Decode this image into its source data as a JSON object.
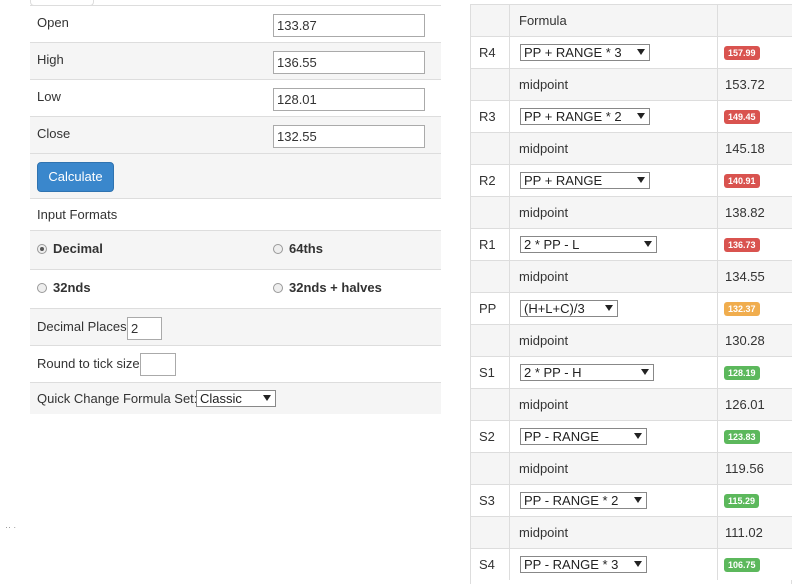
{
  "inputs": {
    "open_label": "Open",
    "open_value": "133.87",
    "high_label": "High",
    "high_value": "136.55",
    "low_label": "Low",
    "low_value": "128.01",
    "close_label": "Close",
    "close_value": "132.55"
  },
  "calculate_label": "Calculate",
  "input_formats": {
    "heading": "Input Formats",
    "options": [
      "Decimal",
      "64ths",
      "32nds",
      "32nds + halves"
    ],
    "selected": "Decimal"
  },
  "decimal_places": {
    "label": "Decimal Places",
    "value": "2"
  },
  "tick_size": {
    "label": "Round to tick size",
    "value": ""
  },
  "formula_set": {
    "label": "Quick Change Formula Set:",
    "value": "Classic"
  },
  "colors": {
    "red": "#d9534f",
    "orange": "#f0ad4e",
    "green": "#5cb85c",
    "button": "#3a87cc"
  },
  "table": {
    "header": "Formula",
    "midpoint_label": "midpoint",
    "rows": [
      {
        "label": "R4",
        "formula": "PP + RANGE * 3",
        "value": "157.99",
        "color": "red",
        "midpoint": "153.72"
      },
      {
        "label": "R3",
        "formula": "PP + RANGE * 2",
        "value": "149.45",
        "color": "red",
        "midpoint": "145.18"
      },
      {
        "label": "R2",
        "formula": "PP + RANGE",
        "value": "140.91",
        "color": "red",
        "midpoint": "138.82"
      },
      {
        "label": "R1",
        "formula": "2 * PP - L",
        "value": "136.73",
        "color": "red",
        "midpoint": "134.55"
      },
      {
        "label": "PP",
        "formula": "(H+L+C)/3",
        "value": "132.37",
        "color": "orange",
        "midpoint": "130.28"
      },
      {
        "label": "S1",
        "formula": "2 * PP - H",
        "value": "128.19",
        "color": "green",
        "midpoint": "126.01"
      },
      {
        "label": "S2",
        "formula": "PP - RANGE",
        "value": "123.83",
        "color": "green",
        "midpoint": "119.56"
      },
      {
        "label": "S3",
        "formula": "PP - RANGE * 2",
        "value": "115.29",
        "color": "green",
        "midpoint": "111.02"
      },
      {
        "label": "S4",
        "formula": "PP - RANGE * 3",
        "value": "106.75",
        "color": "green",
        "midpoint": null
      }
    ]
  },
  "stray_mark": "‥ ."
}
